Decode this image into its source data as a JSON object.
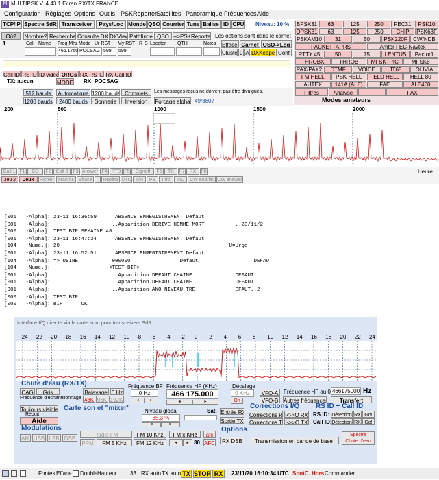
{
  "window": {
    "title": "MULTIPSK V. 4.43.1  Ecran RX/TX  FRANCE",
    "menu": [
      "Configuration",
      "Réglages",
      "Options",
      "Outils",
      "PSKReporter",
      "Satellites",
      "Panoramique",
      "Fréquences",
      "Aide"
    ]
  },
  "toolbar1": {
    "buttons": [
      "TCP/IP",
      "Spectre SdR",
      "Transceiver",
      "Pays/Loc",
      "Monde",
      "QSO",
      "Courrier",
      "Tune",
      "Balise",
      "ID",
      "CPU"
    ],
    "level_text": "Niveau: 10 %"
  },
  "logbar": {
    "buttons": [
      "Où?",
      "Nombre?",
      "Recherche",
      "Consulte DXC",
      "DXView",
      "Pathfinder",
      "QSO",
      "-->PSKReporter"
    ],
    "note": "Les options sont dans le carnet",
    "headers": [
      "Call",
      "Name",
      "Freq Mhz",
      "Mode",
      "Ur RST",
      "My RST",
      "R",
      "S",
      "Locator",
      "QTH",
      "Notes"
    ],
    "row_index": "1",
    "freq": "466.1750",
    "mode": "POCSAG",
    "ur_rst": "599",
    "my_rst": "599",
    "right_buttons": [
      "Effacer",
      "Carnet",
      "QSO->Log",
      "Cluster",
      "L",
      "A",
      "DXKeeper",
      "Conf"
    ]
  },
  "modes_grid": [
    [
      "BPSK31",
      "63",
      "125",
      "250",
      "FEC31",
      "PSK10"
    ],
    [
      "QPSK31",
      "63",
      "125",
      "250",
      "CHIP",
      "PSK63F"
    ],
    [
      "PSKAM10",
      "31",
      "50",
      "PSK220F",
      "CW/NDB"
    ],
    [
      "PACKET+APRS",
      "Amtor FEC-Navtex"
    ],
    [
      "RTTY 45",
      "50",
      "75",
      "LENTUS",
      "Pactor1"
    ],
    [
      "THROBX",
      "THROB",
      "MFSK+PIC",
      "MFSK8"
    ],
    [
      "PAX/PAX2",
      "DTMF",
      "VOICE",
      "JT65",
      "OLIVIA"
    ],
    [
      "FM HELL",
      "PSK HELL",
      "FELD HELL",
      "HELL 80"
    ],
    [
      "AUTEX",
      "141A (ALE)",
      "FAE",
      "ALE400"
    ]
  ],
  "modes_bottom": [
    "Filtres",
    "Analyse",
    "",
    "FAX"
  ],
  "modes_title": "Modes amateurs",
  "call_tabs": [
    "Call ID",
    "RS ID",
    "ID vidéo",
    "QRGs",
    "RX RS ID",
    "RX Call ID"
  ],
  "tx_status": "TX: aucun",
  "mode_label": "MODE",
  "rx_status": "RX: POCSAG",
  "pocsag": {
    "bauds": [
      "512 bauds",
      "1200 bauds",
      "2400 bauds"
    ],
    "auto": "Automatique",
    "b1200": "1200 bauds",
    "complets": "Complets",
    "message": "Les messages reçus ne doivent pas être divulgués.",
    "sonnerie": "Sonnerie",
    "inversion": "Inversion",
    "forcage": "Forçage alpha",
    "counter": "49/3807"
  },
  "spectrum": {
    "ticks": [
      "200",
      "500",
      "1000",
      "1500",
      "2000"
    ],
    "heure": "Heure"
  },
  "macro_row1": [
    "Call 1",
    "F1",
    "CQ",
    "F2",
    "Call 3",
    "F3",
    "Answer",
    "F4",
    "RTB",
    "F5",
    "Signoff",
    "F6",
    "TX",
    "F7",
    "RX",
    "F8"
  ],
  "macro_row2": [
    "Jeu 2",
    "Jeux",
    "Fichier",
    "Macros",
    "Efface",
    "",
    "Répète",
    "UTC",
    "T/R",
    "PB",
    "Info",
    "TID",
    "CW end/fin",
    "CW answer"
  ],
  "rx_text": [
    "[001   -Alpha]: 23-11 16:36:59      ABSENCE ENREGISTREMENT Defaut",
    "[001   -Alpha]:                    ..Apparition DERIVE HOMME MORT          ..23/11/2",
    "[000   -Alpha]: TEST BIP SEMAINE 48",
    "[001   -Alpha]: 23-11 16:47:34      ABSENCE ENREGISTREMENT Defaut",
    "[104   -Nume.]: 20                                                       U=Urge",
    "[001   -Alpha]: 23-11 16:52:51      ABSENCE ENREGISTREMENT Defaut",
    "[104   -Alpha]: => USINE           000000                Defaut                  DEFAUT",
    "[104   -Nume.]:                   <TEST BIP>",
    "[001   -Alpha]:                    ..Apparition DEFAUT CHAINE              DEFAUT.",
    "[001   -Alpha]:                    ..Apparition DEFAUT CHAINE              DEFAUT.",
    "[001   -Alpha]:                    ..Apparition ANO NIVEAU TRE             EFAUT..2",
    "[000   -Alpha]: TEST BIP",
    "[000   -Alpha]: BIP      OK"
  ],
  "iq": {
    "caption": "Interface I/Q directe via la carte son, pour transceivers SdR",
    "ticks": [
      "-24",
      "-22",
      "-20",
      "-18",
      "-16",
      "-14",
      "-12",
      "-10",
      "-8",
      "-6",
      "-4",
      "-2",
      "0",
      "2",
      "4",
      "6",
      "8",
      "10",
      "12",
      "14",
      "16",
      "18",
      "20",
      "22",
      "24"
    ],
    "waterfall_title": "Chute d'eau (RX/TX)",
    "cag": "CAG",
    "gris": "Gris",
    "balayage": "Balayage",
    "zero_hz": "0 Hz",
    "freq_echant": "Fréquence d'échantillonnage",
    "f48": "48K",
    "f96": "96K",
    "f192": "192K",
    "freq_bf_label": "Fréquence BF",
    "freq_bf_value": "0 Hz",
    "freq_hf_label": "Fréquence HF (KHz)",
    "freq_hf_value": "466 175.000",
    "decalage_label": "Décalage",
    "decalage_value": "0 KHz",
    "on": "On",
    "vfo_a": "VFO-A",
    "vfo_b": "VFO-B",
    "freq_hf_au0": "Fréquence HF au 0",
    "hf_input": "466175000",
    "hz": "Hz",
    "autres_freq": "Autres fréquences",
    "transfert": "Transfert",
    "toujours_visible": "Toujours visible",
    "reduit": "Réduit",
    "aide": "Aide",
    "carte_son": "Carte son et \"mixer\"",
    "niveau_global": "Niveau global",
    "niveau_value": "35.3 %",
    "sat": "Sat.",
    "entree_rx": "Entrée RX",
    "sortie_tx": "Sortie TX",
    "corrections_title": "Corrections I/Q",
    "corr_rx": "Corrections RX",
    "corr_tx": "Corrections TX",
    "iq_swap1": "I<->Q RX",
    "iq_swap2": "I<->Q TX",
    "rsid_title": "RS ID + Call ID",
    "rsid_label": "RS ID:",
    "callid_label": "Call ID:",
    "detection": "Détection",
    "rx": "RX",
    "go": "Go!",
    "modulations_title": "Modulations",
    "mod_am": "AM",
    "mod_usb": "USB",
    "mod_lsb": "LSB",
    "mod_dsb": "DSB",
    "radio_fm": "Radio FM",
    "ppm": "PPM",
    "fm10": "FM 10 Khz",
    "fm5": "FM 5 KHz",
    "fm12": "FM 12 KHz",
    "fmx": "FM x KHz",
    "afc": "afc",
    "afc2": "AFC",
    "val30": "30",
    "options_title": "Options",
    "rx_dsb": "RX DSB",
    "transmission": "Transmission en bande de base",
    "spectre_chute": "Spectre\nChute d'eau"
  },
  "statusbar": {
    "items": [
      "Fontes",
      "Efface",
      "Double",
      "Hauteur",
      "33",
      "RX auto",
      "TX auto",
      "TX",
      "STOP",
      "RX"
    ],
    "datetime": "23/11/20 16:10:34 UTC",
    "spotc": "SpotC. Hors",
    "commander": "Commander"
  },
  "colors": {
    "accent_blue": "#1f4f9e",
    "red": "#d01010",
    "yellow": "#ffe000",
    "pink": "#f6c6c6",
    "cyan": "#5ad5f0"
  }
}
